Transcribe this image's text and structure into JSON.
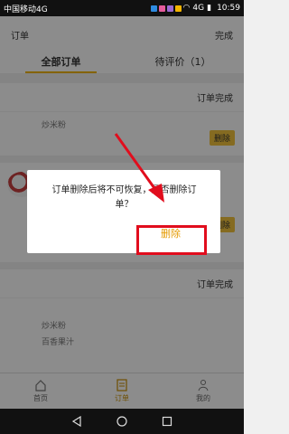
{
  "status": {
    "carrier": "中国移动4G",
    "time": "10:59",
    "network": "4G"
  },
  "header": {
    "title": "订单",
    "right_action": "完成"
  },
  "tabs": [
    {
      "label": "全部订单"
    },
    {
      "label": "待评价（1）"
    }
  ],
  "orders": [
    {
      "status": "订单完成",
      "items": [
        "炒米粉"
      ],
      "delete_label": "删除"
    },
    {
      "status": "",
      "items": [],
      "delete_label": "删除"
    },
    {
      "status": "订单完成",
      "items": [
        "炒米粉",
        "百香果汁"
      ],
      "delete_label": ""
    }
  ],
  "dialog": {
    "message": "订单删除后将不可恢复，是否删除订单？",
    "confirm_label": "删除"
  },
  "bottom_nav": [
    {
      "label": "首页",
      "icon": "home-icon"
    },
    {
      "label": "订单",
      "icon": "order-icon"
    },
    {
      "label": "我的",
      "icon": "profile-icon"
    }
  ],
  "colors": {
    "accent": "#f2c43d",
    "highlight": "#e10d1d",
    "confirm_text": "#e59a00"
  }
}
